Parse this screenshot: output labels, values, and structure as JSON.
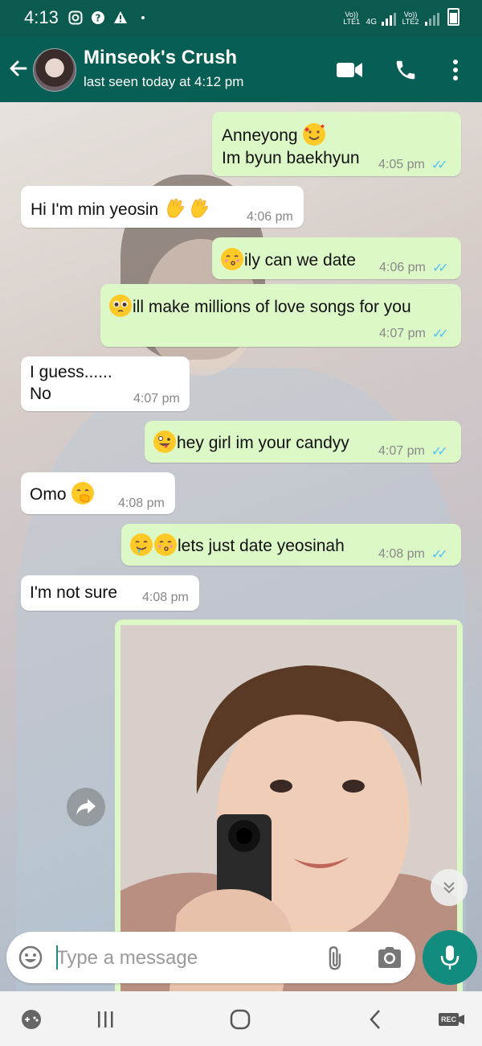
{
  "status_bar": {
    "time": "4:13",
    "sim1_label": "Vo)) LTE1",
    "network_label": "4G",
    "sim2_label": "Vo)) LTE2"
  },
  "header": {
    "contact_name": "Minseok's Crush",
    "last_seen": "last seen today at 4:12 pm"
  },
  "messages": [
    {
      "dir": "out",
      "text_line1": "Anneyong",
      "text_line2": "Im byun baekhyun",
      "time": "4:05 pm",
      "ticks": "✓✓"
    },
    {
      "dir": "in",
      "text": "Hi I'm min yeosin",
      "time": "4:06 pm"
    },
    {
      "dir": "out",
      "text": "ily can we date",
      "time": "4:06 pm",
      "ticks": "✓✓"
    },
    {
      "dir": "out",
      "text": "ill make millions of love songs for you",
      "time": "4:07 pm",
      "ticks": "✓✓"
    },
    {
      "dir": "in",
      "text_line1": "I guess......",
      "text_line2": "No",
      "time": "4:07 pm"
    },
    {
      "dir": "out",
      "text": "hey girl im your candyy",
      "time": "4:07 pm",
      "ticks": "✓✓"
    },
    {
      "dir": "in",
      "text": "Omo",
      "time": "4:08 pm"
    },
    {
      "dir": "out",
      "text": "lets just date yeosinah",
      "time": "4:08 pm",
      "ticks": "✓✓"
    },
    {
      "dir": "in",
      "text": "I'm not sure",
      "time": "4:08 pm"
    }
  ],
  "composer": {
    "placeholder": "Type a message"
  },
  "icons": {
    "back": "arrow-left-icon",
    "video": "video-call-icon",
    "call": "phone-icon",
    "menu": "more-vert-icon",
    "emoji": "emoji-icon",
    "attach": "paperclip-icon",
    "camera": "camera-icon",
    "mic": "mic-icon",
    "forward": "forward-icon",
    "scroll_down": "double-chevron-down-icon"
  },
  "nav": {
    "rec_label": "REC"
  },
  "colors": {
    "header": "#075e54",
    "status_bar": "#0b5a4f",
    "outgoing_bubble": "#dcf8c6",
    "incoming_bubble": "#ffffff",
    "read_ticks": "#4fc3f7",
    "mic_button": "#128c7e"
  }
}
